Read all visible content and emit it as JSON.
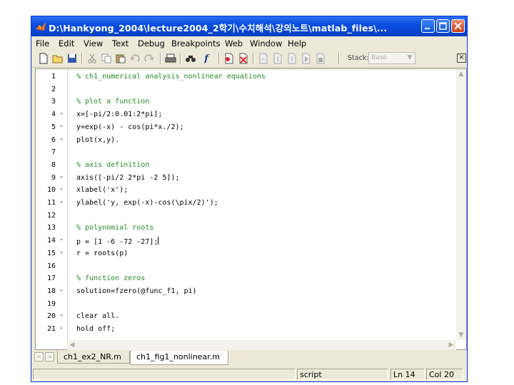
{
  "window": {
    "title": "D:\\Hankyong_2004\\lecture2004_2학기\\수치해석\\강의노트\\matlab_files\\..."
  },
  "menu": [
    "File",
    "Edit",
    "View",
    "Text",
    "Debug",
    "Breakpoints",
    "Web",
    "Window",
    "Help"
  ],
  "toolbar": {
    "stack_label": "Stack:",
    "stack_value": "Base"
  },
  "editor": {
    "lines": [
      {
        "num": "1",
        "dash": "",
        "code": "% ch1_numerical analysis_nonlinear equations",
        "comment": true
      },
      {
        "num": "2",
        "dash": "",
        "code": "",
        "comment": false
      },
      {
        "num": "3",
        "dash": "",
        "code": "% plot a function",
        "comment": true
      },
      {
        "num": "4",
        "dash": "-",
        "code": "x=[-pi/2:0.01:2*pi];",
        "comment": false
      },
      {
        "num": "5",
        "dash": "-",
        "code": "y=exp(-x) - cos(pi*x./2);",
        "comment": false
      },
      {
        "num": "6",
        "dash": "-",
        "code": "plot(x,y).",
        "comment": false
      },
      {
        "num": "7",
        "dash": "",
        "code": "",
        "comment": false
      },
      {
        "num": "8",
        "dash": "",
        "code": "% axis definition",
        "comment": true
      },
      {
        "num": "9",
        "dash": "-",
        "code": "axis([-pi/2 2*pi -2 5]);",
        "comment": false
      },
      {
        "num": "10",
        "dash": "-",
        "code": "xlabel('x');",
        "comment": false
      },
      {
        "num": "11",
        "dash": "-",
        "code": "ylabel('y, exp(-x)-cos(\\pix/2)');",
        "comment": false
      },
      {
        "num": "12",
        "dash": "",
        "code": "",
        "comment": false
      },
      {
        "num": "13",
        "dash": "",
        "code": "% polynomial roots",
        "comment": true
      },
      {
        "num": "14",
        "dash": "-",
        "code": "p = [1 -6 -72 -27];",
        "comment": false,
        "caret": true
      },
      {
        "num": "15",
        "dash": "-",
        "code": "r = roots(p)",
        "comment": false
      },
      {
        "num": "16",
        "dash": "",
        "code": "",
        "comment": false
      },
      {
        "num": "17",
        "dash": "",
        "code": "% function zeros",
        "comment": true
      },
      {
        "num": "18",
        "dash": "-",
        "code": "solution=fzero(@func_f1, pi)",
        "comment": false
      },
      {
        "num": "19",
        "dash": "",
        "code": "",
        "comment": false
      },
      {
        "num": "20",
        "dash": "-",
        "code": "clear all.",
        "comment": false
      },
      {
        "num": "21",
        "dash": "-",
        "code": "hold off;",
        "comment": false
      }
    ]
  },
  "tabs": [
    {
      "label": "ch1_ex2_NR.m",
      "active": false
    },
    {
      "label": "ch1_fig1_nonlinear.m",
      "active": true
    }
  ],
  "status": {
    "mode": "script",
    "line": "Ln 14",
    "col": "Col 20"
  },
  "colors": {
    "titlebar": "#0a4ee0",
    "comment": "#228b22"
  }
}
